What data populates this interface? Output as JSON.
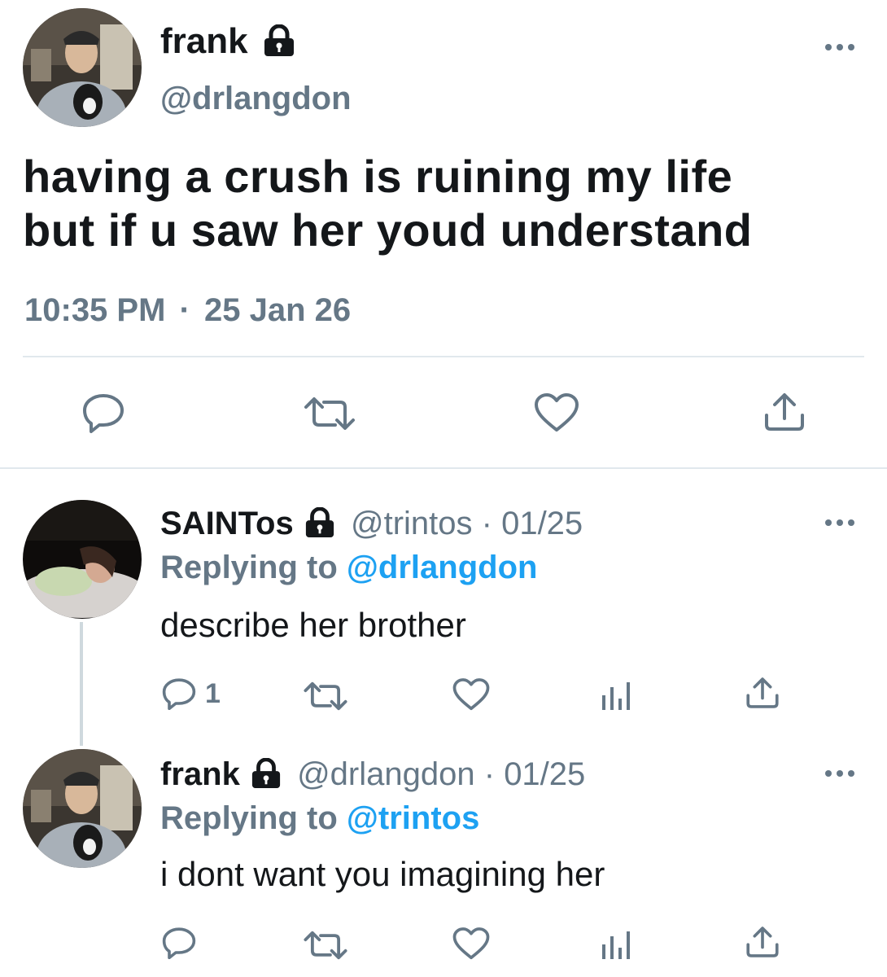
{
  "main_tweet": {
    "display_name": "frank",
    "handle": "@drlangdon",
    "text_line1": "having a crush is ruining my life",
    "text_line2": "but if u saw her youd understand",
    "time": "10:35 PM",
    "separator": "·",
    "date": "25 Jan 26"
  },
  "replies": [
    {
      "display_name": "SAINTos",
      "handle": "@trintos",
      "separator": "·",
      "date": "01/25",
      "replying_label": "Replying to",
      "replying_to": "@drlangdon",
      "text": "describe her brother",
      "reply_count": "1"
    },
    {
      "display_name": "frank",
      "handle": "@drlangdon",
      "separator": "·",
      "date": "01/25",
      "replying_label": "Replying to",
      "replying_to": "@trintos",
      "text": "i dont want you imagining her",
      "reply_count": ""
    }
  ],
  "icons": {
    "lock": "lock-icon",
    "reply": "reply-icon",
    "retweet": "retweet-icon",
    "like": "heart-icon",
    "analytics": "analytics-icon",
    "share": "share-icon",
    "more": "more-icon"
  },
  "colors": {
    "text": "#14171a",
    "secondary": "#657786",
    "link": "#1da1f2",
    "divider": "#e1e8ed"
  }
}
